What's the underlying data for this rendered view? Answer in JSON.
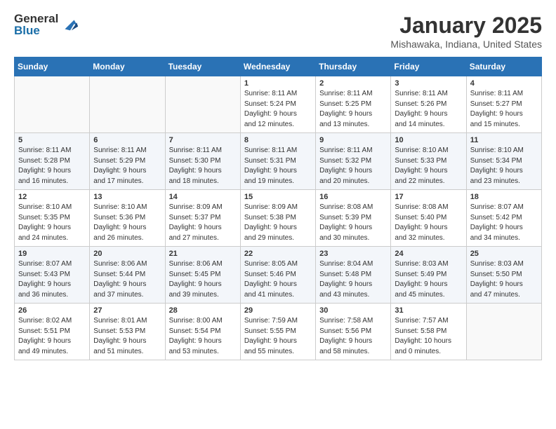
{
  "logo": {
    "general": "General",
    "blue": "Blue"
  },
  "title": "January 2025",
  "subtitle": "Mishawaka, Indiana, United States",
  "weekdays": [
    "Sunday",
    "Monday",
    "Tuesday",
    "Wednesday",
    "Thursday",
    "Friday",
    "Saturday"
  ],
  "weeks": [
    [
      {
        "day": "",
        "info": ""
      },
      {
        "day": "",
        "info": ""
      },
      {
        "day": "",
        "info": ""
      },
      {
        "day": "1",
        "info": "Sunrise: 8:11 AM\nSunset: 5:24 PM\nDaylight: 9 hours\nand 12 minutes."
      },
      {
        "day": "2",
        "info": "Sunrise: 8:11 AM\nSunset: 5:25 PM\nDaylight: 9 hours\nand 13 minutes."
      },
      {
        "day": "3",
        "info": "Sunrise: 8:11 AM\nSunset: 5:26 PM\nDaylight: 9 hours\nand 14 minutes."
      },
      {
        "day": "4",
        "info": "Sunrise: 8:11 AM\nSunset: 5:27 PM\nDaylight: 9 hours\nand 15 minutes."
      }
    ],
    [
      {
        "day": "5",
        "info": "Sunrise: 8:11 AM\nSunset: 5:28 PM\nDaylight: 9 hours\nand 16 minutes."
      },
      {
        "day": "6",
        "info": "Sunrise: 8:11 AM\nSunset: 5:29 PM\nDaylight: 9 hours\nand 17 minutes."
      },
      {
        "day": "7",
        "info": "Sunrise: 8:11 AM\nSunset: 5:30 PM\nDaylight: 9 hours\nand 18 minutes."
      },
      {
        "day": "8",
        "info": "Sunrise: 8:11 AM\nSunset: 5:31 PM\nDaylight: 9 hours\nand 19 minutes."
      },
      {
        "day": "9",
        "info": "Sunrise: 8:11 AM\nSunset: 5:32 PM\nDaylight: 9 hours\nand 20 minutes."
      },
      {
        "day": "10",
        "info": "Sunrise: 8:10 AM\nSunset: 5:33 PM\nDaylight: 9 hours\nand 22 minutes."
      },
      {
        "day": "11",
        "info": "Sunrise: 8:10 AM\nSunset: 5:34 PM\nDaylight: 9 hours\nand 23 minutes."
      }
    ],
    [
      {
        "day": "12",
        "info": "Sunrise: 8:10 AM\nSunset: 5:35 PM\nDaylight: 9 hours\nand 24 minutes."
      },
      {
        "day": "13",
        "info": "Sunrise: 8:10 AM\nSunset: 5:36 PM\nDaylight: 9 hours\nand 26 minutes."
      },
      {
        "day": "14",
        "info": "Sunrise: 8:09 AM\nSunset: 5:37 PM\nDaylight: 9 hours\nand 27 minutes."
      },
      {
        "day": "15",
        "info": "Sunrise: 8:09 AM\nSunset: 5:38 PM\nDaylight: 9 hours\nand 29 minutes."
      },
      {
        "day": "16",
        "info": "Sunrise: 8:08 AM\nSunset: 5:39 PM\nDaylight: 9 hours\nand 30 minutes."
      },
      {
        "day": "17",
        "info": "Sunrise: 8:08 AM\nSunset: 5:40 PM\nDaylight: 9 hours\nand 32 minutes."
      },
      {
        "day": "18",
        "info": "Sunrise: 8:07 AM\nSunset: 5:42 PM\nDaylight: 9 hours\nand 34 minutes."
      }
    ],
    [
      {
        "day": "19",
        "info": "Sunrise: 8:07 AM\nSunset: 5:43 PM\nDaylight: 9 hours\nand 36 minutes."
      },
      {
        "day": "20",
        "info": "Sunrise: 8:06 AM\nSunset: 5:44 PM\nDaylight: 9 hours\nand 37 minutes."
      },
      {
        "day": "21",
        "info": "Sunrise: 8:06 AM\nSunset: 5:45 PM\nDaylight: 9 hours\nand 39 minutes."
      },
      {
        "day": "22",
        "info": "Sunrise: 8:05 AM\nSunset: 5:46 PM\nDaylight: 9 hours\nand 41 minutes."
      },
      {
        "day": "23",
        "info": "Sunrise: 8:04 AM\nSunset: 5:48 PM\nDaylight: 9 hours\nand 43 minutes."
      },
      {
        "day": "24",
        "info": "Sunrise: 8:03 AM\nSunset: 5:49 PM\nDaylight: 9 hours\nand 45 minutes."
      },
      {
        "day": "25",
        "info": "Sunrise: 8:03 AM\nSunset: 5:50 PM\nDaylight: 9 hours\nand 47 minutes."
      }
    ],
    [
      {
        "day": "26",
        "info": "Sunrise: 8:02 AM\nSunset: 5:51 PM\nDaylight: 9 hours\nand 49 minutes."
      },
      {
        "day": "27",
        "info": "Sunrise: 8:01 AM\nSunset: 5:53 PM\nDaylight: 9 hours\nand 51 minutes."
      },
      {
        "day": "28",
        "info": "Sunrise: 8:00 AM\nSunset: 5:54 PM\nDaylight: 9 hours\nand 53 minutes."
      },
      {
        "day": "29",
        "info": "Sunrise: 7:59 AM\nSunset: 5:55 PM\nDaylight: 9 hours\nand 55 minutes."
      },
      {
        "day": "30",
        "info": "Sunrise: 7:58 AM\nSunset: 5:56 PM\nDaylight: 9 hours\nand 58 minutes."
      },
      {
        "day": "31",
        "info": "Sunrise: 7:57 AM\nSunset: 5:58 PM\nDaylight: 10 hours\nand 0 minutes."
      },
      {
        "day": "",
        "info": ""
      }
    ]
  ]
}
